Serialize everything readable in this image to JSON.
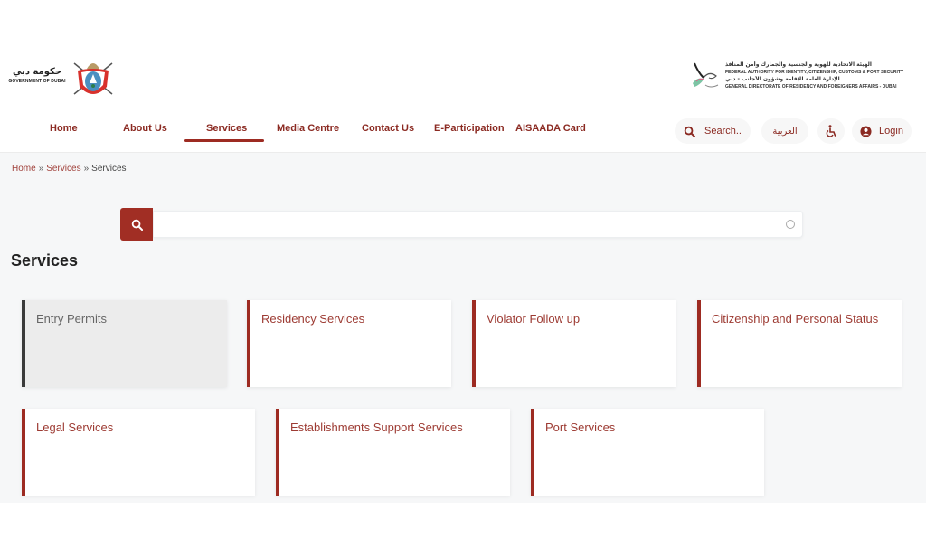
{
  "header": {
    "gov_logo": {
      "arabic_text": "حكومة دبي",
      "english_text": "GOVERNMENT OF DUBAI"
    },
    "authority_logo": {
      "line1_ar": "الهيئة الاتحادية للهوية والجنسية والجمارك وأمن المنافذ",
      "line2_en": "FEDERAL AUTHORITY FOR IDENTITY, CITIZENSHIP, CUSTOMS & PORT SECURITY",
      "line3_ar": "الإدارة العامة للإقامة وشؤون الأجانب - دبي",
      "line4_en": "GENERAL DIRECTORATE OF RESIDENCY AND FOREIGNERS AFFAIRS - DUBAI"
    }
  },
  "nav": {
    "items": [
      {
        "label": "Home"
      },
      {
        "label": "About Us"
      },
      {
        "label": "Services",
        "active": true
      },
      {
        "label": "Media Centre"
      },
      {
        "label": "Contact Us"
      },
      {
        "label": "E-Participation"
      },
      {
        "label": "AISAADA Card"
      }
    ]
  },
  "tools": {
    "search_label": "Search..",
    "language_label": "العربية",
    "accessibility_icon": "wheelchair-icon",
    "login_label": "Login"
  },
  "breadcrumb": {
    "items": [
      "Home",
      "Services",
      "Services"
    ],
    "separator": "»"
  },
  "search": {
    "placeholder": "",
    "value": ""
  },
  "page_title": "Services",
  "services": [
    {
      "title": "Entry Permits",
      "active": true
    },
    {
      "title": "Residency Services"
    },
    {
      "title": "Violator Follow up"
    },
    {
      "title": "Citizenship and Personal Status"
    },
    {
      "title": "Legal Services"
    },
    {
      "title": "Establishments Support Services"
    },
    {
      "title": "Port Services"
    }
  ],
  "colors": {
    "accent": "#9d2b22",
    "accent_dark": "#8b2a22",
    "active_card_border": "#3a3a3a",
    "background": "#f6f7f8"
  }
}
